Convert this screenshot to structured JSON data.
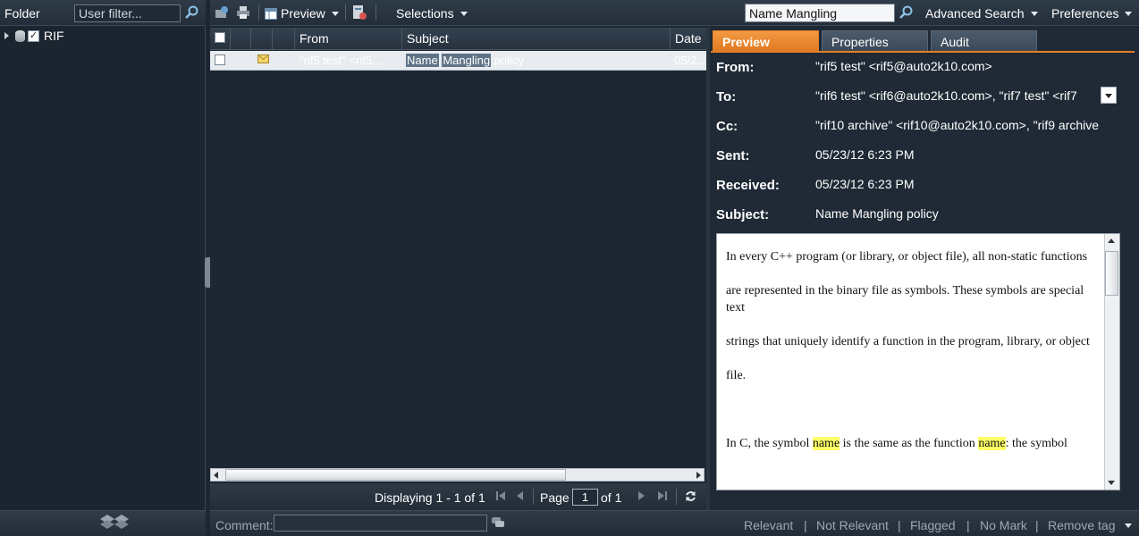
{
  "folder": {
    "title": "Folder",
    "filter_placeholder": "User filter...",
    "tree": [
      {
        "label": "RIF",
        "checked": "✓"
      }
    ]
  },
  "toolbar": {
    "preview_label": "Preview",
    "selections_label": "Selections",
    "search_value": "Name Mangling",
    "advanced_search_label": "Advanced Search",
    "preferences_label": "Preferences"
  },
  "grid": {
    "columns": [
      "From",
      "Subject",
      "Date"
    ],
    "rows": [
      {
        "from": "\"rif5 test\" <rif5...",
        "subject_parts": [
          "Name",
          "Mangling",
          "policy"
        ],
        "date": "05/2..."
      }
    ]
  },
  "pager": {
    "displaying": "Displaying 1 - 1 of 1",
    "page_label": "Page",
    "page_value": "1",
    "of_label": "of 1"
  },
  "bottom": {
    "comment_label": "Comment:",
    "actions": [
      "Relevant",
      "|",
      "Not Relevant",
      "|",
      "Flagged",
      "|",
      "No Mark",
      "|",
      "Remove tag"
    ]
  },
  "preview": {
    "tabs": [
      "Preview",
      "Properties",
      "Audit"
    ],
    "fields": [
      {
        "key": "From:",
        "value": "\"rif5 test\" <rif5@auto2k10.com>"
      },
      {
        "key": "To:",
        "value": "\"rif6 test\" <rif6@auto2k10.com>, \"rif7 test\" <rif7"
      },
      {
        "key": "Cc:",
        "value": "\"rif10 archive\" <rif10@auto2k10.com>, \"rif9 archive"
      },
      {
        "key": "Sent:",
        "value": "05/23/12 6:23 PM"
      },
      {
        "key": "Received:",
        "value": "05/23/12 6:23 PM"
      },
      {
        "key": "Subject:",
        "value": "Name Mangling policy"
      }
    ],
    "body": {
      "p1": "In every C++ program (or library, or object file), all non-static functions",
      "p2": "are represented in the binary file as symbols. These symbols are special text",
      "p3": "strings that uniquely identify a function in the program, library, or object",
      "p4": "file.",
      "p5_a": "In C, the symbol ",
      "p5_hl1": "name",
      "p5_b": " is the same as the function ",
      "p5_hl2": "name",
      "p5_c": ": the symbol"
    }
  },
  "colors": {
    "accent_tab": "#e47f25",
    "highlight": "#ffff66"
  }
}
